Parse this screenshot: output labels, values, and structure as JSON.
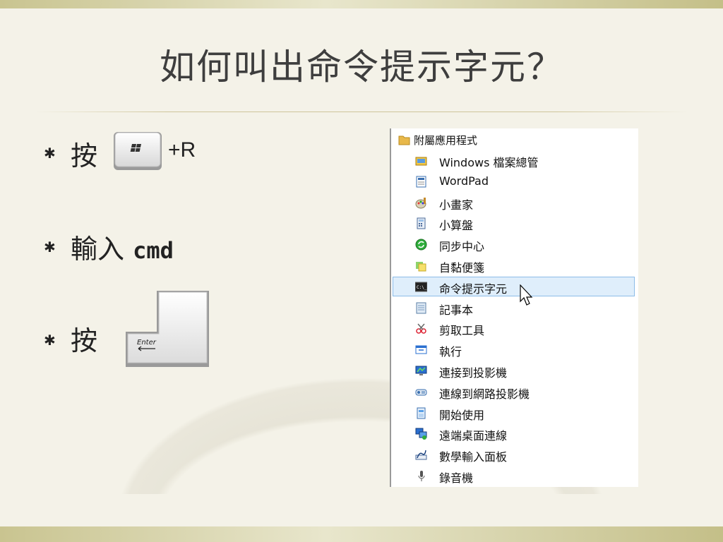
{
  "slide": {
    "title": "如何叫出命令提示字元？",
    "bullet_symbol": "✱",
    "bullets": [
      {
        "text": "按",
        "suffix": "+R"
      },
      {
        "text": "輸入",
        "code": "cmd"
      },
      {
        "text": "按"
      }
    ],
    "keys": {
      "enter_label": "Enter"
    }
  },
  "menu": {
    "folder": "附屬應用程式",
    "items": [
      {
        "label": "Windows 檔案總管",
        "icon": "explorer-icon"
      },
      {
        "label": "WordPad",
        "icon": "wordpad-icon"
      },
      {
        "label": "小畫家",
        "icon": "paint-icon"
      },
      {
        "label": "小算盤",
        "icon": "calculator-icon"
      },
      {
        "label": "同步中心",
        "icon": "sync-center-icon"
      },
      {
        "label": "自黏便箋",
        "icon": "sticky-notes-icon"
      },
      {
        "label": "命令提示字元",
        "icon": "command-prompt-icon",
        "selected": true
      },
      {
        "label": "記事本",
        "icon": "notepad-icon"
      },
      {
        "label": "剪取工具",
        "icon": "snipping-tool-icon"
      },
      {
        "label": "執行",
        "icon": "run-icon"
      },
      {
        "label": "連接到投影機",
        "icon": "projector-icon"
      },
      {
        "label": "連線到網路投影機",
        "icon": "network-projector-icon"
      },
      {
        "label": "開始使用",
        "icon": "getting-started-icon"
      },
      {
        "label": "遠端桌面連線",
        "icon": "remote-desktop-icon"
      },
      {
        "label": "數學輸入面板",
        "icon": "math-input-icon"
      },
      {
        "label": "錄音機",
        "icon": "sound-recorder-icon"
      }
    ],
    "cmd_icon_text": "C:\\_"
  }
}
